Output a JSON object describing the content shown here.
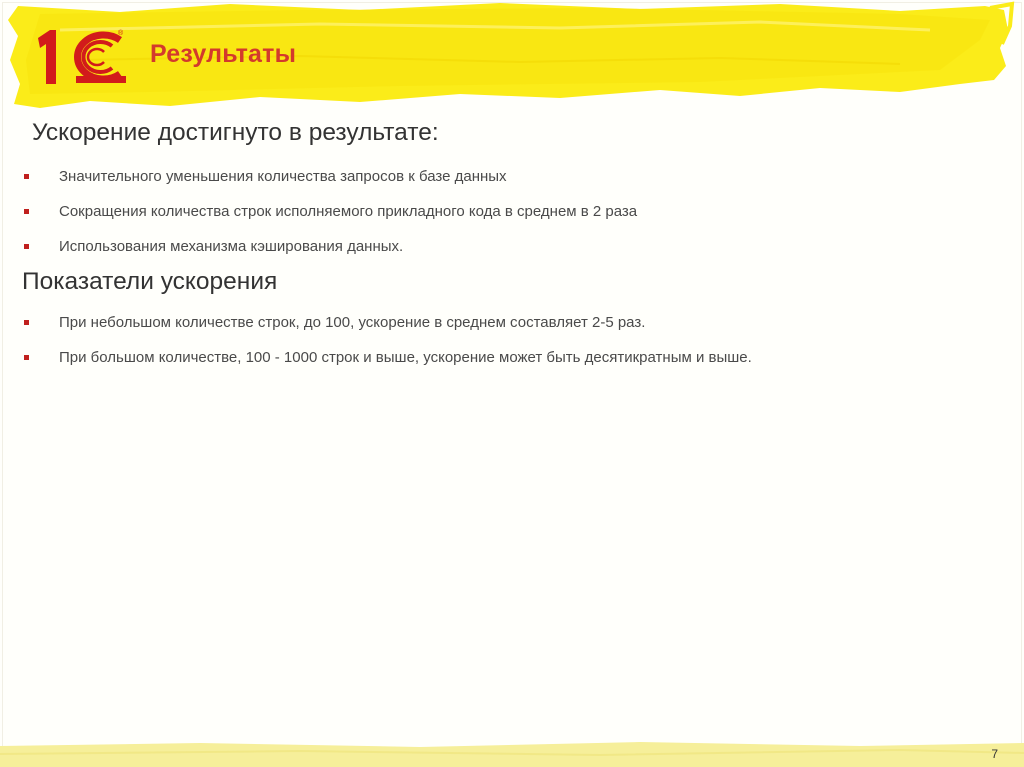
{
  "header": {
    "title": "Результаты"
  },
  "logo": {
    "text": "1С",
    "registered_mark": "®"
  },
  "sections": [
    {
      "heading": "Ускорение достигнуто в результате:",
      "items": [
        "Значительного уменьшения количества запросов к базе данных",
        "Сокращения количества строк исполняемого прикладного кода в среднем в 2 раза",
        "Использования механизма кэширования данных."
      ]
    },
    {
      "heading": "Показатели ускорения",
      "items": [
        "При небольшом количестве строк, до 100, ускорение в среднем составляет 2-5 раз.",
        "При большом количестве, 100 - 1000 строк и выше, ускорение может быть десятикратным и выше."
      ]
    }
  ],
  "footer": {
    "page_number": "7"
  },
  "colors": {
    "brush": "#fbec19",
    "title": "#d33a2c",
    "logo_red": "#d21b1b",
    "bullet": "#c0201d"
  }
}
